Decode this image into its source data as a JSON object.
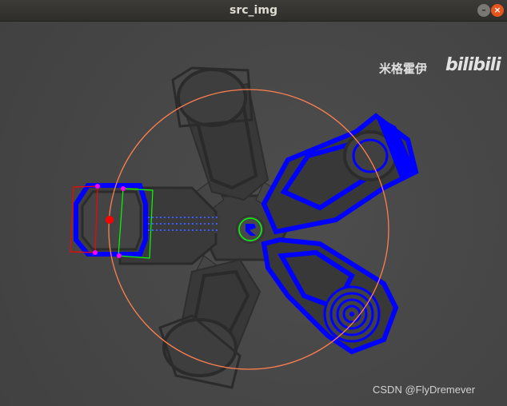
{
  "window": {
    "title": "src_img",
    "minimize_glyph": "–",
    "close_glyph": "×"
  },
  "watermarks": {
    "top_text": "米格霍伊",
    "logo_text": "bilibili",
    "bottom_text": "CSDN @FlyDremever"
  },
  "colors": {
    "highlight": "#0000ff",
    "arm_dark": "#3b3b3b",
    "circle_outline": "#ff7f50",
    "box_red": "#ff0000",
    "box_green": "#00ff00",
    "marker_magenta": "#ff00ff",
    "marker_red": "#ff0000",
    "center_ring": "#00ff00"
  },
  "icons": {
    "minimize": "minimize-icon",
    "close": "close-icon"
  }
}
